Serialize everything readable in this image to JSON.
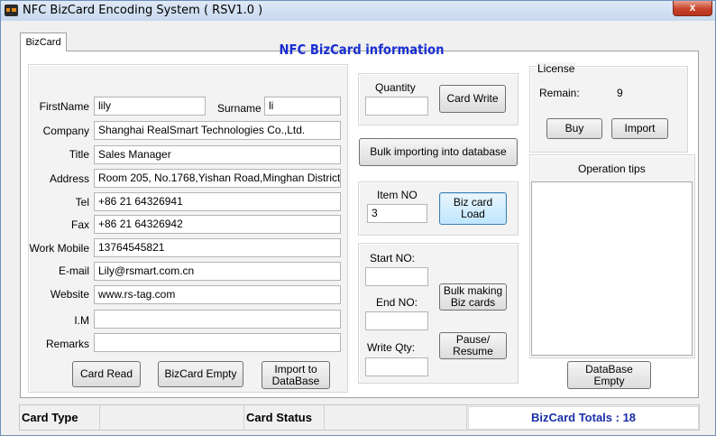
{
  "window": {
    "title": "NFC BizCard Encoding System ( RSV1.0 )",
    "close_glyph": "x"
  },
  "tab": {
    "label": "BizCard"
  },
  "heading": "NFC BizCard information",
  "form": {
    "firstname_label": "FirstName",
    "firstname_value": "lily",
    "surname_label": "Surname",
    "surname_value": "li",
    "company_label": "Company",
    "company_value": "Shanghai RealSmart Technologies Co.,Ltd.",
    "title_label": "Title",
    "title_value": "Sales Manager",
    "address_label": "Address",
    "address_value": "Room 205, No.1768,Yishan Road,Minghan District",
    "tel_label": "Tel",
    "tel_value": "+86 21 64326941",
    "fax_label": "Fax",
    "fax_value": "+86 21 64326942",
    "mobile_label": "Work Mobile",
    "mobile_value": "13764545821",
    "email_label": "E-mail",
    "email_value": "Lily@rsmart.com.cn",
    "website_label": "Website",
    "website_value": "www.rs-tag.com",
    "im_label": "I.M",
    "im_value": "",
    "remarks_label": "Remarks",
    "remarks_value": "",
    "card_read": "Card Read",
    "bizcard_empty": "BizCard Empty",
    "import_db_line1": "Import to",
    "import_db_line2": "DataBase"
  },
  "write": {
    "quantity_label": "Quantity",
    "quantity_value": "",
    "card_write": "Card Write",
    "bulk_import": "Bulk importing into database",
    "item_no_label": "Item NO",
    "item_no_value": "3",
    "biz_card_load": "Biz card Load",
    "start_no_label": "Start NO:",
    "start_no_value": "",
    "end_no_label": "End NO:",
    "end_no_value": "",
    "write_qty_label": "Write Qty:",
    "write_qty_value": "",
    "bulk_making_line1": "Bulk making",
    "bulk_making_line2": "Biz cards",
    "pause_line1": "Pause/",
    "pause_line2": "Resume"
  },
  "license": {
    "title": "License",
    "remain_label": "Remain:",
    "remain_value": "9",
    "buy": "Buy",
    "import": "Import"
  },
  "tips": {
    "title": "Operation tips"
  },
  "database_empty": "DataBase Empty",
  "status": {
    "card_type_label": "Card Type",
    "card_status_label": "Card Status",
    "totals": "BizCard Totals : 18"
  }
}
